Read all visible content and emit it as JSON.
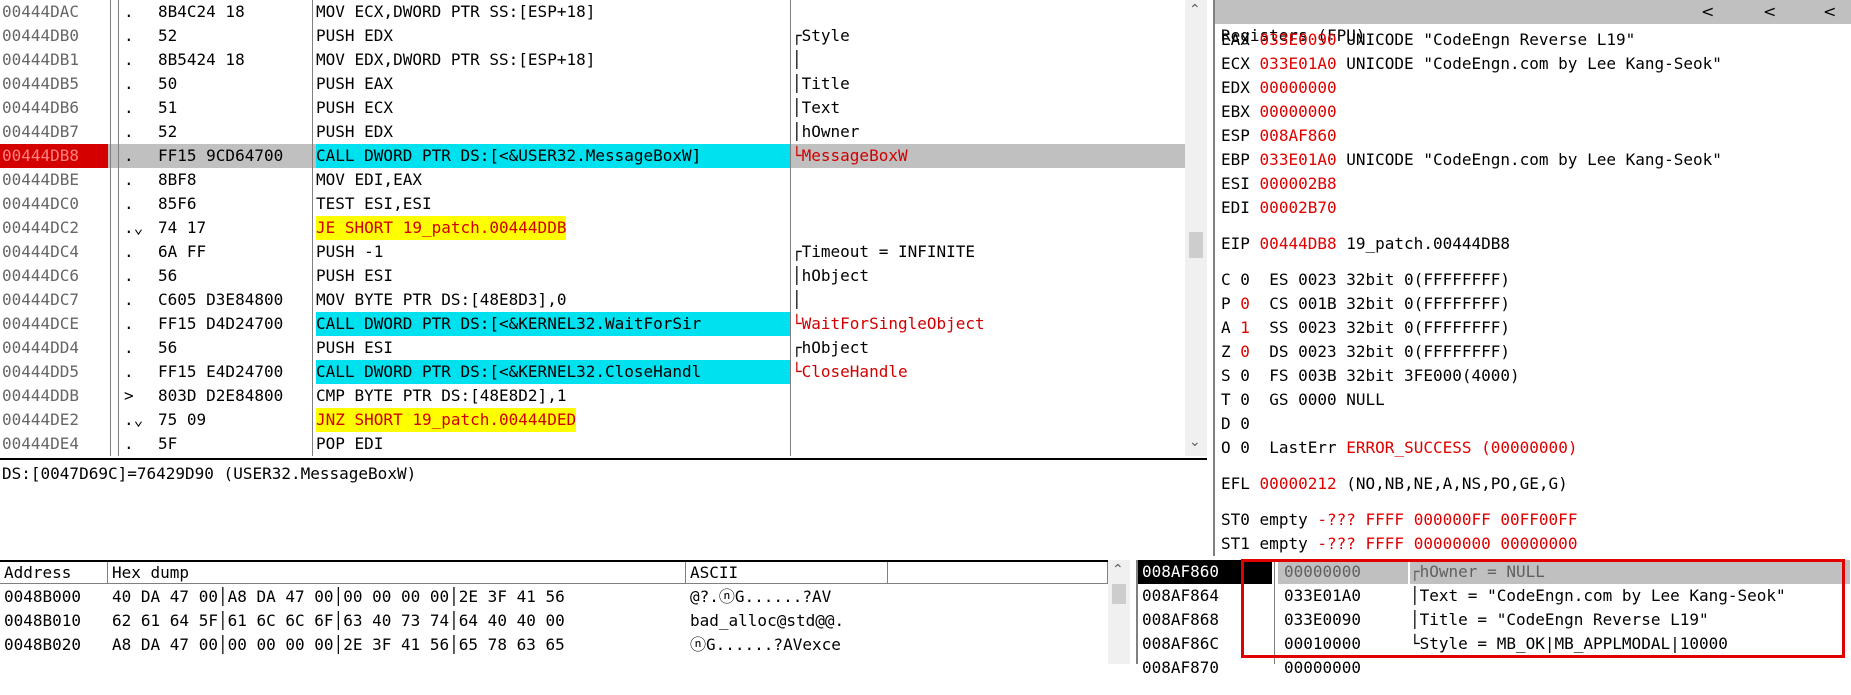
{
  "disasm": {
    "lines": [
      {
        "addr": "00444DAC",
        "mark": ".",
        "hex": "8B4C24 18",
        "ins": "MOV ECX,DWORD PTR SS:[ESP+18]",
        "comment": "",
        "style": ""
      },
      {
        "addr": "00444DB0",
        "mark": ".",
        "hex": "52",
        "ins": "PUSH EDX",
        "comment": "┌Style",
        "style": ""
      },
      {
        "addr": "00444DB1",
        "mark": ".",
        "hex": "8B5424 18",
        "ins": "MOV EDX,DWORD PTR SS:[ESP+18]",
        "comment": "│",
        "style": ""
      },
      {
        "addr": "00444DB5",
        "mark": ".",
        "hex": "50",
        "ins": "PUSH EAX",
        "comment": "│Title",
        "style": ""
      },
      {
        "addr": "00444DB6",
        "mark": ".",
        "hex": "51",
        "ins": "PUSH ECX",
        "comment": "│Text",
        "style": ""
      },
      {
        "addr": "00444DB7",
        "mark": ".",
        "hex": "52",
        "ins": "PUSH EDX",
        "comment": "│hOwner",
        "style": ""
      },
      {
        "addr": "00444DB8",
        "mark": ".",
        "hex": "FF15 9CD64700",
        "ins": "CALL DWORD PTR DS:[<&USER32.MessageBoxW]",
        "comment": "└MessageBoxW",
        "style": "call",
        "current": true,
        "red": true
      },
      {
        "addr": "00444DBE",
        "mark": ".",
        "hex": "8BF8",
        "ins": "MOV EDI,EAX",
        "comment": "",
        "style": ""
      },
      {
        "addr": "00444DC0",
        "mark": ".",
        "hex": "85F6",
        "ins": "TEST ESI,ESI",
        "comment": "",
        "style": ""
      },
      {
        "addr": "00444DC2",
        "mark": ".⌄",
        "hex": "74 17",
        "ins": "JE SHORT 19_patch.00444DDB",
        "comment": "",
        "style": "jmp"
      },
      {
        "addr": "00444DC4",
        "mark": ".",
        "hex": "6A FF",
        "ins": "PUSH -1",
        "comment": "┌Timeout = ",
        "comment_extra": "INFINITE",
        "style": ""
      },
      {
        "addr": "00444DC6",
        "mark": ".",
        "hex": "56",
        "ins": "PUSH ESI",
        "comment": "│hObject",
        "style": ""
      },
      {
        "addr": "00444DC7",
        "mark": ".",
        "hex": "C605 D3E84800",
        "ins": "MOV BYTE PTR DS:[48E8D3],0",
        "comment": "│",
        "style": ""
      },
      {
        "addr": "00444DCE",
        "mark": ".",
        "hex": "FF15 D4D24700",
        "ins": "CALL DWORD PTR DS:[<&KERNEL32.WaitForSir",
        "comment": "└WaitForSingleObject",
        "style": "call",
        "red": true
      },
      {
        "addr": "00444DD4",
        "mark": ".",
        "hex": "56",
        "ins": "PUSH ESI",
        "comment": "┌hObject",
        "style": ""
      },
      {
        "addr": "00444DD5",
        "mark": ".",
        "hex": "FF15 E4D24700",
        "ins": "CALL DWORD PTR DS:[<&KERNEL32.CloseHandl",
        "comment": "└CloseHandle",
        "style": "call",
        "red": true
      },
      {
        "addr": "00444DDB",
        "mark": ">",
        "hex": "803D D2E84800",
        "ins": "CMP BYTE PTR DS:[48E8D2],1",
        "comment": "",
        "style": ""
      },
      {
        "addr": "00444DE2",
        "mark": ".⌄",
        "hex": "75 09",
        "ins": "JNZ SHORT 19_patch.00444DED",
        "comment": "",
        "style": "jmp"
      },
      {
        "addr": "00444DE4",
        "mark": ".",
        "hex": "5F",
        "ins": "POP EDI",
        "comment": "",
        "style": ""
      }
    ]
  },
  "info": {
    "text": "DS:[0047D69C]=76429D90 (USER32.MessageBoxW)"
  },
  "registers": {
    "title": "Registers (FPU)",
    "nav": [
      "<",
      "<",
      "<"
    ],
    "lines": [
      {
        "name": "EAX",
        "value": "033E0090",
        "desc": "UNICODE \"CodeEngn Reverse L19\""
      },
      {
        "name": "ECX",
        "value": "033E01A0",
        "desc": "UNICODE \"CodeEngn.com by Lee Kang-Seok\""
      },
      {
        "name": "EDX",
        "value": "00000000",
        "desc": ""
      },
      {
        "name": "EBX",
        "value": "00000000",
        "desc": ""
      },
      {
        "name": "ESP",
        "value": "008AF860",
        "desc": ""
      },
      {
        "name": "EBP",
        "value": "033E01A0",
        "desc": "UNICODE \"CodeEngn.com by Lee Kang-Seok\""
      },
      {
        "name": "ESI",
        "value": "000002B8",
        "desc": ""
      },
      {
        "name": "EDI",
        "value": "00002B70",
        "desc": ""
      }
    ],
    "eip": {
      "name": "EIP",
      "value": "00444DB8",
      "desc": "19_patch.00444DB8"
    },
    "flags": [
      {
        "flag": "C",
        "val": "0",
        "red": false,
        "seg": "ES 0023 32bit 0(FFFFFFFF)"
      },
      {
        "flag": "P",
        "val": "0",
        "red": true,
        "seg": "CS 001B 32bit 0(FFFFFFFF)"
      },
      {
        "flag": "A",
        "val": "1",
        "red": true,
        "seg": "SS 0023 32bit 0(FFFFFFFF)"
      },
      {
        "flag": "Z",
        "val": "0",
        "red": true,
        "seg": "DS 0023 32bit 0(FFFFFFFF)"
      },
      {
        "flag": "S",
        "val": "0",
        "red": false,
        "seg": "FS 003B 32bit 3FE000(4000)"
      },
      {
        "flag": "T",
        "val": "0",
        "red": false,
        "seg": "GS 0000 NULL"
      },
      {
        "flag": "D",
        "val": "0",
        "red": false,
        "seg": ""
      },
      {
        "flag": "O",
        "val": "0",
        "red": false,
        "seg": "LastErr",
        "lasterr": "ERROR_SUCCESS (00000000)"
      }
    ],
    "efl": {
      "name": "EFL",
      "value": "00000212",
      "desc": "(NO,NB,NE,A,NS,PO,GE,G)"
    },
    "fpu": [
      {
        "name": "ST0",
        "state": "empty",
        "val": "-??? FFFF 000000FF 00FF00FF"
      },
      {
        "name": "ST1",
        "state": "empty",
        "val": "-??? FFFF 00000000 00000000"
      }
    ]
  },
  "dump": {
    "headers": {
      "address": "Address",
      "hex": "Hex dump",
      "ascii": "ASCII"
    },
    "rows": [
      {
        "addr": "0048B000",
        "hex": "40 DA 47 00│A8 DA 47 00│00 00 00 00│2E 3F 41 56",
        "ascii": "@?.ⓝG......?AV"
      },
      {
        "addr": "0048B010",
        "hex": "62 61 64 5F│61 6C 6C 6F│63 40 73 74│64 40 40 00",
        "ascii": "bad_alloc@std@@."
      },
      {
        "addr": "0048B020",
        "hex": "A8 DA 47 00│00 00 00 00│2E 3F 41 56│65 78 63 65",
        "ascii": "ⓝG......?AVexce"
      }
    ]
  },
  "stack": {
    "rows": [
      {
        "addr": "008AF860",
        "val": "00000000",
        "comment": "┌hOwner = NULL",
        "top": true
      },
      {
        "addr": "008AF864",
        "val": "033E01A0",
        "comment": "│Text = \"CodeEngn.com by Lee Kang-Seok\""
      },
      {
        "addr": "008AF868",
        "val": "033E0090",
        "comment": "│Title = \"CodeEngn Reverse L19\""
      },
      {
        "addr": "008AF86C",
        "val": "00010000",
        "comment": "└Style = MB_OK|MB_APPLMODAL|10000"
      },
      {
        "addr": "008AF870",
        "val": "00000000",
        "comment": ""
      }
    ]
  },
  "colors": {
    "accent_red": "#e00000",
    "call_highlight": "#00e1f0",
    "jump_highlight": "#ffff00",
    "selection_gray": "#c0c0c0"
  }
}
